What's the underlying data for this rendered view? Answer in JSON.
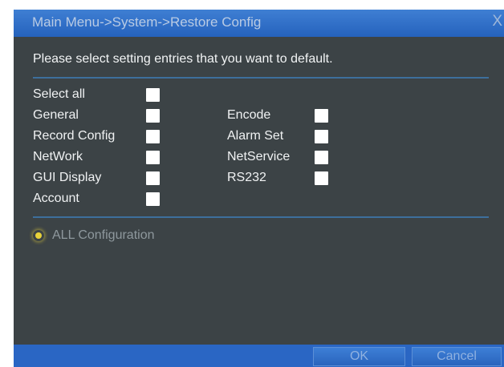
{
  "window": {
    "title": "Main Menu->System->Restore Config",
    "close_glyph": "X"
  },
  "prompt": "Please select setting entries that you want to default.",
  "select_all": {
    "label": "Select all",
    "checked": false
  },
  "left_options": [
    {
      "label": "General",
      "checked": false
    },
    {
      "label": "Record Config",
      "checked": false
    },
    {
      "label": "NetWork",
      "checked": false
    },
    {
      "label": "GUI Display",
      "checked": false
    },
    {
      "label": "Account",
      "checked": false
    }
  ],
  "right_options": [
    {
      "label": "Encode",
      "checked": false
    },
    {
      "label": "Alarm Set",
      "checked": false
    },
    {
      "label": "NetService",
      "checked": false
    },
    {
      "label": "RS232",
      "checked": false
    }
  ],
  "tip": {
    "icon": "lightbulb-icon",
    "text": "ALL Configuration"
  },
  "buttons": {
    "ok": "OK",
    "cancel": "Cancel"
  },
  "colors": {
    "background": "#3c4346",
    "titlebar": "#2a66c4",
    "separator": "#3d6f9c",
    "checkbox": "#ffffff"
  }
}
